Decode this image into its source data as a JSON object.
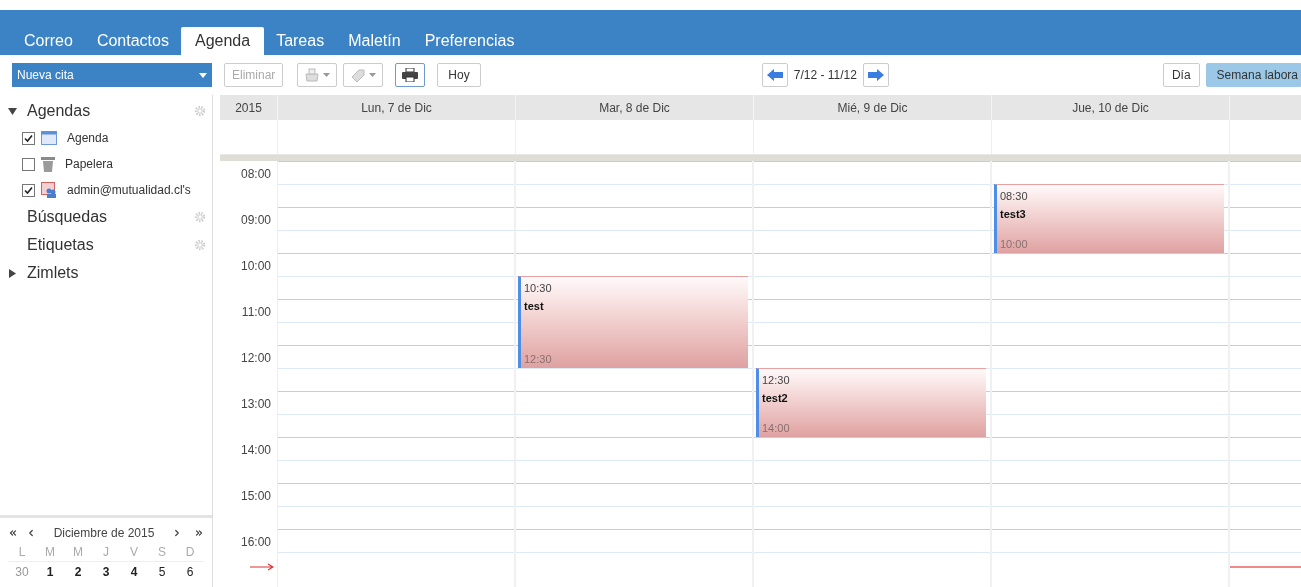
{
  "app_tabs": [
    {
      "label": "Correo",
      "selected": false
    },
    {
      "label": "Contactos",
      "selected": false
    },
    {
      "label": "Agenda",
      "selected": true
    },
    {
      "label": "Tareas",
      "selected": false
    },
    {
      "label": "Maletín",
      "selected": false
    },
    {
      "label": "Preferencias",
      "selected": false
    }
  ],
  "toolbar": {
    "new_button": "Nueva cita",
    "delete_button": {
      "label": "Eliminar",
      "disabled": true
    },
    "today_button": "Hoy",
    "range": "7/12 - 11/12",
    "views": [
      {
        "label": "Día",
        "selected": false
      },
      {
        "label": "Semana labora",
        "selected": true
      }
    ]
  },
  "sidebar": {
    "sections": [
      {
        "label": "Agendas",
        "expanded": true,
        "gear": true,
        "children": [
          {
            "label": "Agenda",
            "checked": true,
            "kind": "calendar"
          },
          {
            "label": "Papelera",
            "checked": false,
            "kind": "trash"
          },
          {
            "label": "admin@mutualidad.cl's",
            "checked": true,
            "kind": "shared"
          }
        ]
      },
      {
        "label": "Búsquedas",
        "gear": true
      },
      {
        "label": "Etiquetas",
        "gear": true
      },
      {
        "label": "Zimlets",
        "expanded": false,
        "gear": false
      }
    ]
  },
  "mini_calendar": {
    "title": "Diciembre de 2015",
    "weekdays": [
      "L",
      "M",
      "M",
      "J",
      "V",
      "S",
      "D"
    ],
    "days": [
      {
        "label": "30",
        "in_month": false,
        "bold": false
      },
      {
        "label": "1",
        "in_month": true,
        "bold": true
      },
      {
        "label": "2",
        "in_month": true,
        "bold": true
      },
      {
        "label": "3",
        "in_month": true,
        "bold": true
      },
      {
        "label": "4",
        "in_month": true,
        "bold": true
      },
      {
        "label": "5",
        "in_month": true,
        "bold": false
      },
      {
        "label": "6",
        "in_month": true,
        "bold": false
      }
    ]
  },
  "calendar": {
    "year": "2015",
    "hours": [
      "08:00",
      "09:00",
      "10:00",
      "11:00",
      "12:00",
      "13:00",
      "14:00",
      "15:00",
      "16:00"
    ],
    "days": [
      {
        "label": "Lun, 7 de Dic"
      },
      {
        "label": "Mar, 8 de Dic",
        "events": [
          {
            "start": "10:30",
            "title": "test",
            "end": "12:30"
          }
        ]
      },
      {
        "label": "Mié, 9 de Dic",
        "events": [
          {
            "start": "12:30",
            "title": "test2",
            "end": "14:00"
          }
        ]
      },
      {
        "label": "Jue, 10 de Dic",
        "events": [
          {
            "start": "08:30",
            "title": "test3",
            "end": "10:00"
          }
        ]
      }
    ]
  }
}
